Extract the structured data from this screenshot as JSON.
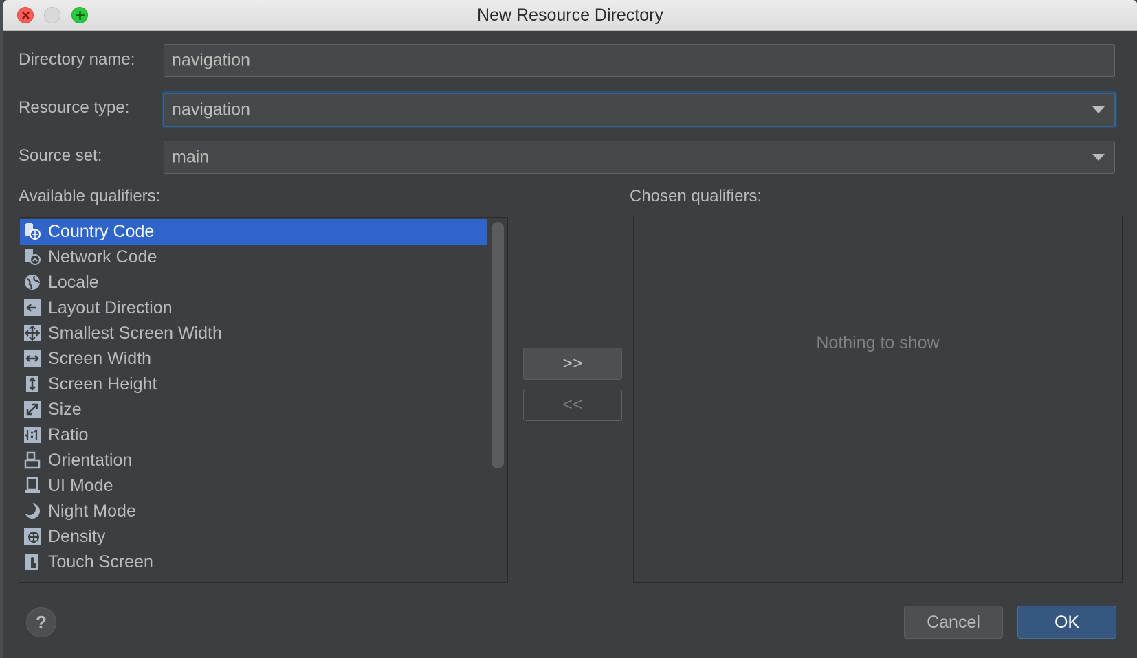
{
  "window": {
    "title": "New Resource Directory"
  },
  "form": {
    "directory_name": {
      "label": "Directory name:",
      "value": "navigation"
    },
    "resource_type": {
      "label": "Resource type:",
      "value": "navigation"
    },
    "source_set": {
      "label": "Source set:",
      "value": "main"
    }
  },
  "qualifiers": {
    "available_label": "Available qualifiers:",
    "chosen_label": "Chosen qualifiers:",
    "available": [
      {
        "label": "Country Code",
        "icon": "country-code-icon",
        "selected": true
      },
      {
        "label": "Network Code",
        "icon": "network-code-icon",
        "selected": false
      },
      {
        "label": "Locale",
        "icon": "globe-icon",
        "selected": false
      },
      {
        "label": "Layout Direction",
        "icon": "layout-direction-icon",
        "selected": false
      },
      {
        "label": "Smallest Screen Width",
        "icon": "smallest-width-icon",
        "selected": false
      },
      {
        "label": "Screen Width",
        "icon": "screen-width-icon",
        "selected": false
      },
      {
        "label": "Screen Height",
        "icon": "screen-height-icon",
        "selected": false
      },
      {
        "label": "Size",
        "icon": "size-icon",
        "selected": false
      },
      {
        "label": "Ratio",
        "icon": "ratio-icon",
        "selected": false
      },
      {
        "label": "Orientation",
        "icon": "orientation-icon",
        "selected": false
      },
      {
        "label": "UI Mode",
        "icon": "ui-mode-icon",
        "selected": false
      },
      {
        "label": "Night Mode",
        "icon": "night-mode-icon",
        "selected": false
      },
      {
        "label": "Density",
        "icon": "density-icon",
        "selected": false
      },
      {
        "label": "Touch Screen",
        "icon": "touch-screen-icon",
        "selected": false
      }
    ],
    "chosen_empty_text": "Nothing to show",
    "add_button": ">>",
    "remove_button": "<<"
  },
  "footer": {
    "help": "?",
    "cancel": "Cancel",
    "ok": "OK"
  },
  "colors": {
    "background": "#3c3f41",
    "selection": "#2f65ca",
    "primary_button": "#365880",
    "focus_ring": "#3d6185"
  }
}
